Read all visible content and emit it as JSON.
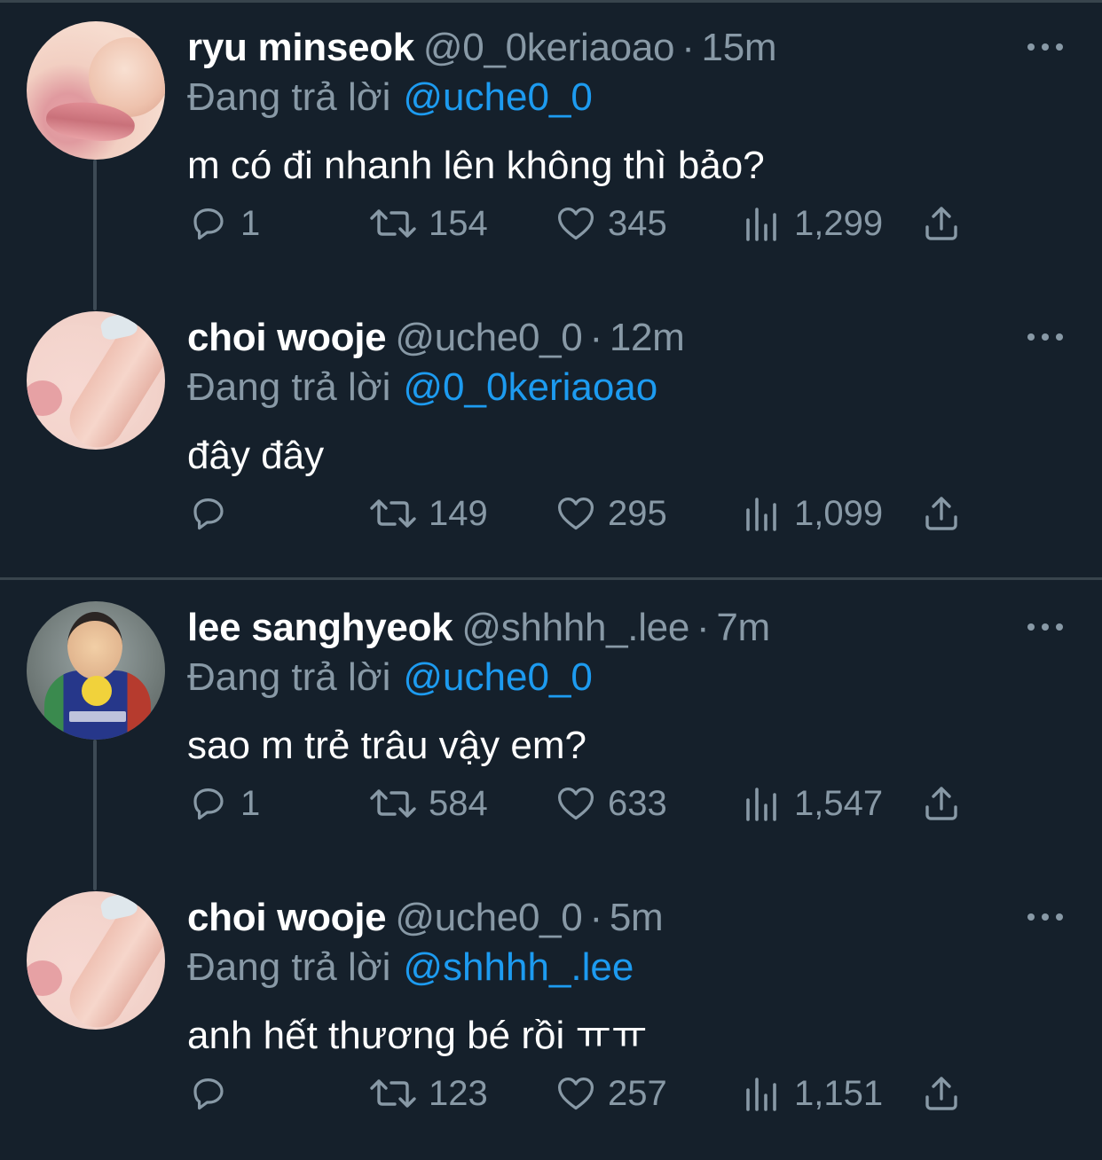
{
  "tweets": [
    {
      "display_name": "ryu minseok",
      "handle": "@0_0keriaoao",
      "time": "15m",
      "reply_label": "Đang trả lời",
      "reply_to": "@uche0_0",
      "text": "m có đi nhanh lên không thì bảo?",
      "replies": "1",
      "retweets": "154",
      "likes": "345",
      "views": "1,299",
      "avatar": "lips-avatar"
    },
    {
      "display_name": "choi wooje",
      "handle": "@uche0_0",
      "time": "12m",
      "reply_label": "Đang trả lời",
      "reply_to": "@0_0keriaoao",
      "text": "đây đây",
      "replies": "",
      "retweets": "149",
      "likes": "295",
      "views": "1,099",
      "avatar": "finger-avatar"
    },
    {
      "display_name": "lee sanghyeok",
      "handle": "@shhhh_.lee",
      "time": "7m",
      "reply_label": "Đang trả lời",
      "reply_to": "@uche0_0",
      "text": "sao m trẻ trâu vậy em?",
      "replies": "1",
      "retweets": "584",
      "likes": "633",
      "views": "1,547",
      "avatar": "kid-avatar"
    },
    {
      "display_name": "choi wooje",
      "handle": "@uche0_0",
      "time": "5m",
      "reply_label": "Đang trả lời",
      "reply_to": "@shhhh_.lee",
      "text": "anh hết thương bé rồi ㅠㅠ",
      "replies": "",
      "retweets": "123",
      "likes": "257",
      "views": "1,151",
      "avatar": "finger-avatar"
    }
  ],
  "dot_separator": "·",
  "icons": {
    "reply": "reply-icon",
    "retweet": "retweet-icon",
    "like": "heart-icon",
    "views": "views-icon",
    "share": "share-icon",
    "more": "more-icon"
  },
  "colors": {
    "background": "#15202b",
    "secondary_text": "#8899a6",
    "link": "#1d9bf0",
    "divider": "#38444d"
  }
}
